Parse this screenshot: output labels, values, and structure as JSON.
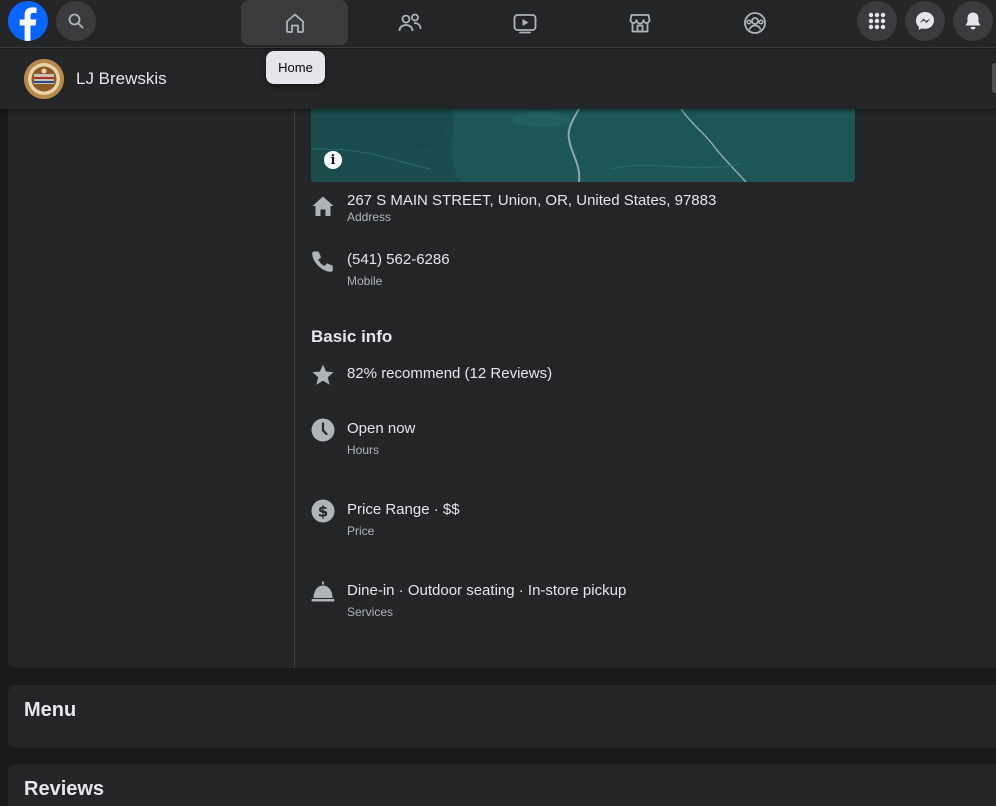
{
  "nav": {
    "tooltip": "Home",
    "tabs": [
      {
        "name": "home",
        "icon": "home-icon"
      },
      {
        "name": "friends",
        "icon": "friends-icon"
      },
      {
        "name": "watch",
        "icon": "video-icon"
      },
      {
        "name": "marketplace",
        "icon": "marketplace-icon"
      },
      {
        "name": "groups",
        "icon": "groups-icon"
      }
    ],
    "right": [
      "menu-grid-icon",
      "messenger-icon",
      "notifications-icon"
    ]
  },
  "header": {
    "page_name": "LJ Brewskis"
  },
  "contact": {
    "address": "267 S MAIN STREET, Union, OR, United States, 97883",
    "address_label": "Address",
    "phone": "(541) 562-6286",
    "phone_label": "Mobile"
  },
  "basic_info": {
    "title": "Basic info",
    "rating": "82% recommend (12 Reviews)",
    "hours": "Open now",
    "hours_label": "Hours",
    "price": "Price Range · $$",
    "price_label": "Price",
    "services": "Dine-in · Outdoor seating · In-store pickup",
    "services_label": "Services"
  },
  "sections": {
    "menu": "Menu",
    "reviews": "Reviews"
  },
  "colors": {
    "brand": "#0866ff",
    "surface": "#242526",
    "background": "#18191a",
    "icon": "#b0b3b8"
  }
}
